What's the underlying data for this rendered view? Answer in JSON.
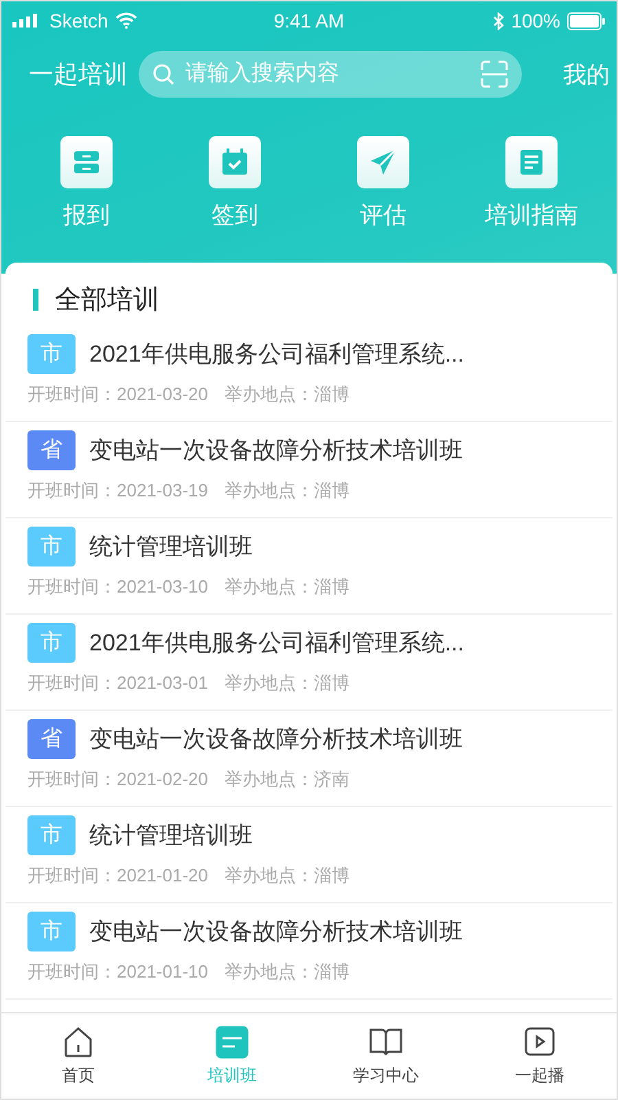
{
  "status_bar": {
    "carrier": "Sketch",
    "time": "9:41 AM",
    "battery": "100%"
  },
  "header": {
    "title": "一起培训",
    "search": {
      "placeholder": "请输入搜索内容"
    },
    "profile": "我的"
  },
  "actions": [
    {
      "label": "报到",
      "kind": "cabinet"
    },
    {
      "label": "签到",
      "kind": "calendar"
    },
    {
      "label": "评估",
      "kind": "plane"
    },
    {
      "label": "培训指南",
      "kind": "note"
    }
  ],
  "section_title": "全部培训",
  "trainings": [
    {
      "tag": "市",
      "color": "#5bcbfd",
      "title": "2021年供电服务公司福利管理系统...",
      "date_label": "开班时间：",
      "date": "2021-03-20",
      "place_label": "举办地点：",
      "place": "淄博"
    },
    {
      "tag": "省",
      "color": "#5b8af5",
      "title": "变电站一次设备故障分析技术培训班",
      "date_label": "开班时间：",
      "date": "2021-03-19",
      "place_label": "举办地点：",
      "place": "淄博"
    },
    {
      "tag": "市",
      "color": "#5bcbfd",
      "title": "统计管理培训班",
      "date_label": "开班时间：",
      "date": "2021-03-10",
      "place_label": "举办地点：",
      "place": "淄博"
    },
    {
      "tag": "市",
      "color": "#5bcbfd",
      "title": "2021年供电服务公司福利管理系统...",
      "date_label": "开班时间：",
      "date": "2021-03-01",
      "place_label": "举办地点：",
      "place": "淄博"
    },
    {
      "tag": "省",
      "color": "#5b8af5",
      "title": "变电站一次设备故障分析技术培训班",
      "date_label": "开班时间：",
      "date": "2021-02-20",
      "place_label": "举办地点：",
      "place": "济南"
    },
    {
      "tag": "市",
      "color": "#5bcbfd",
      "title": "统计管理培训班",
      "date_label": "开班时间：",
      "date": "2021-01-20",
      "place_label": "举办地点：",
      "place": "淄博"
    },
    {
      "tag": "市",
      "color": "#5bcbfd",
      "title": "变电站一次设备故障分析技术培训班",
      "date_label": "开班时间：",
      "date": "2021-01-10",
      "place_label": "举办地点：",
      "place": "淄博"
    }
  ],
  "tab_bar": [
    {
      "label": "首页",
      "kind": "home",
      "selected": false
    },
    {
      "label": "培训班",
      "kind": "list",
      "selected": true
    },
    {
      "label": "学习中心",
      "kind": "book",
      "selected": false
    },
    {
      "label": "一起播",
      "kind": "play",
      "selected": false
    }
  ]
}
